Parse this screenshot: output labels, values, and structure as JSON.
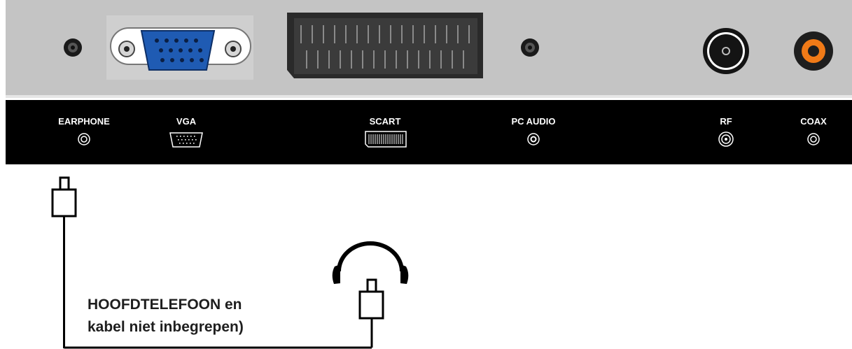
{
  "ports": {
    "earphone": "EARPHONE",
    "vga": "VGA",
    "scart": "SCART",
    "pc_audio": "PC AUDIO",
    "rf": "RF",
    "coax": "COAX"
  },
  "caption": {
    "line1": "HOOFDTELEFOON en",
    "line2": "kabel niet inbegrepen)"
  },
  "colors": {
    "panel_grey": "#c4c4c4",
    "label_strip": "#000000",
    "vga_blue": "#1f5bb3",
    "coax_orange": "#f07a17"
  },
  "icons": [
    "earphone-jack-icon",
    "vga-connector-icon",
    "scart-connector-icon",
    "audio-jack-icon",
    "rf-connector-icon",
    "coax-connector-icon",
    "headphones-icon",
    "plug-icon"
  ]
}
